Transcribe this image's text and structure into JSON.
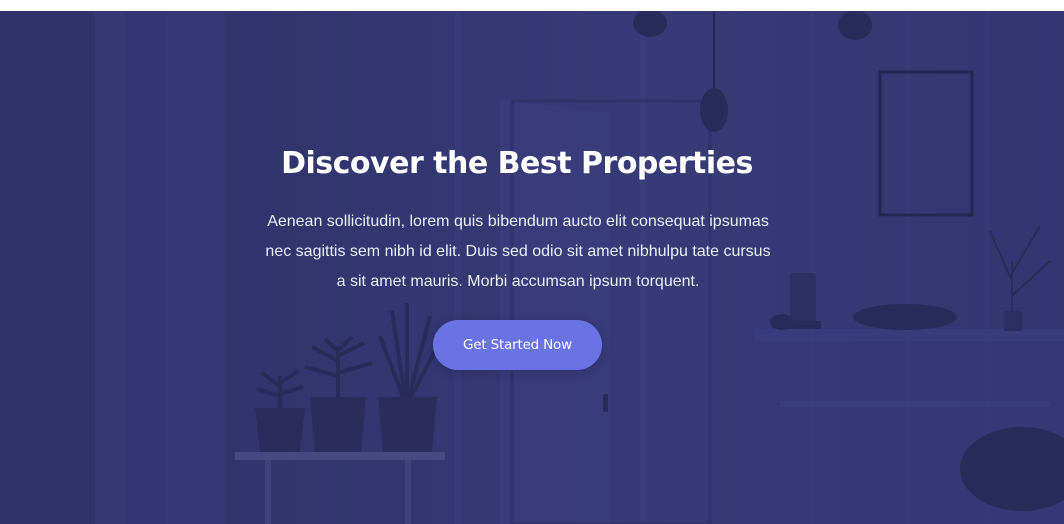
{
  "hero": {
    "title": "Discover the Best Properties",
    "description": "Aenean sollicitudin, lorem quis bibendum aucto elit consequat ipsumas nec sagittis sem nibh id elit. Duis sed odio sit amet nibhulpu tate cursus a sit amet mauris. Morbi accumsan ipsum torquent.",
    "cta_label": "Get Started Now",
    "overlay_color": "#33366f",
    "button_color": "#6a73e3"
  }
}
